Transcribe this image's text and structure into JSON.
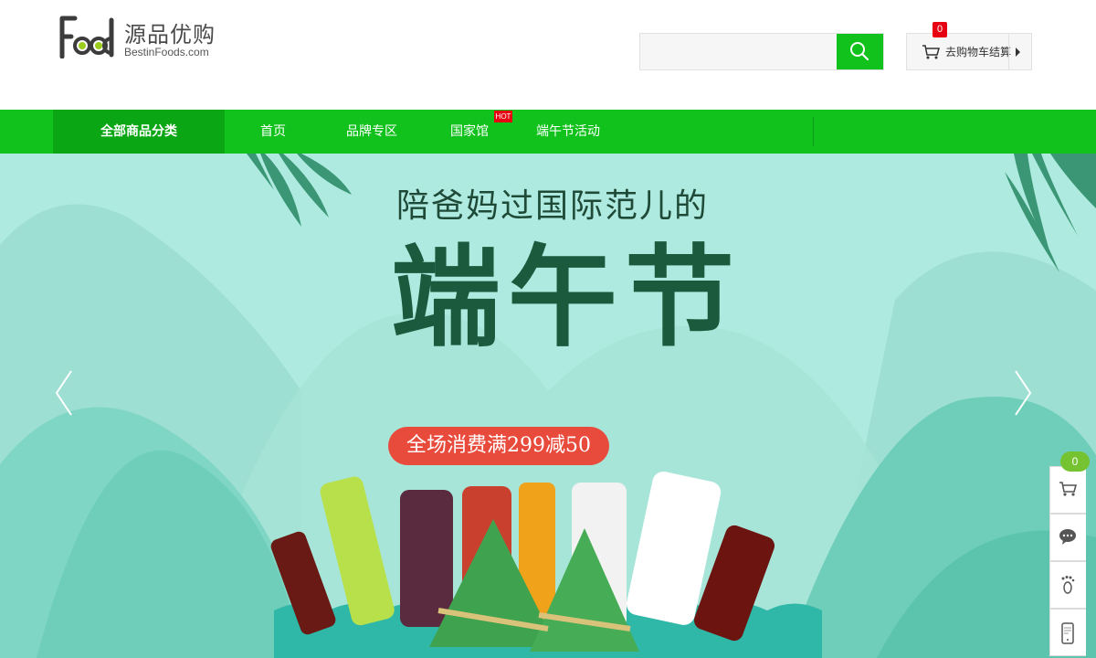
{
  "logo": {
    "cn": "源品优购",
    "en": "BestinFoods.com"
  },
  "search": {
    "value": "",
    "placeholder": ""
  },
  "cart": {
    "label": "去购物车结算",
    "count": "0"
  },
  "nav": {
    "all_categories": "全部商品分类",
    "items": [
      "首页",
      "品牌专区",
      "国家馆",
      "端午节活动"
    ],
    "hot_badge": "HOT"
  },
  "banner": {
    "headline": "陪爸妈过国际范儿的",
    "title": "端午节",
    "promo": "全场消费满299减50"
  },
  "side_toolbar": {
    "cart_count": "0"
  },
  "colors": {
    "brand_green": "#11c21c",
    "nav_dark_green": "#0aa613",
    "badge_red": "#e60012",
    "banner_bg": "#aeeadf"
  }
}
